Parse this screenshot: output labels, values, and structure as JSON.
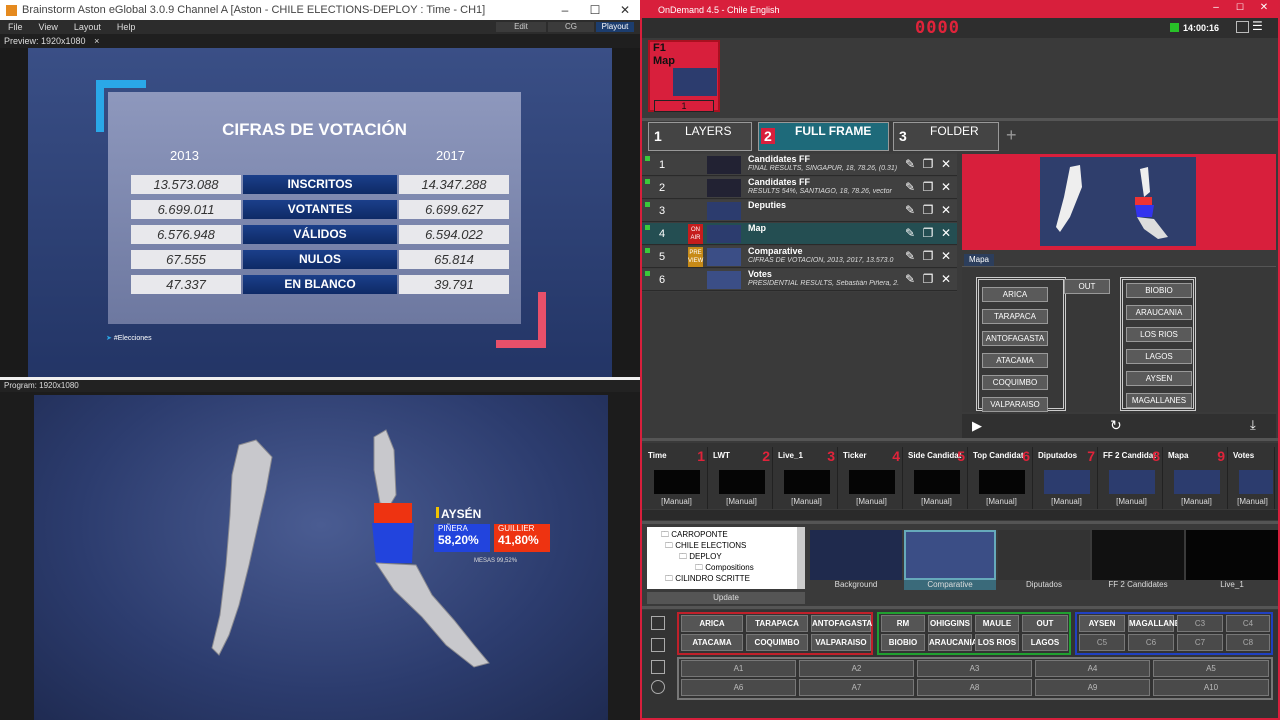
{
  "left_window": {
    "title": "Brainstorm Aston eGlobal 3.0.9  Channel A [Aston - CHILE ELECTIONS-DEPLOY : Time - CH1]",
    "menu": [
      "File",
      "View",
      "Layout",
      "Help"
    ],
    "mode_buttons": [
      "Edit",
      "CG",
      "Playout"
    ],
    "preview_tab": "Preview: 1920x1080",
    "program_tab": "Program: 1920x1080",
    "preview_graphic": {
      "title": "CIFRAS DE VOTACIÓN",
      "year_left": "2013",
      "year_right": "2017",
      "rows": [
        {
          "left": "13.573.088",
          "label": "INSCRITOS",
          "right": "14.347.288"
        },
        {
          "left": "6.699.011",
          "label": "VOTANTES",
          "right": "6.699.627"
        },
        {
          "left": "6.576.948",
          "label": "VÁLIDOS",
          "right": "6.594.022"
        },
        {
          "left": "67.555",
          "label": "NULOS",
          "right": "65.814"
        },
        {
          "left": "47.337",
          "label": "EN BLANCO",
          "right": "39.791"
        }
      ],
      "hashtag": "#Elecciones",
      "accent_blue": "#2aa8e8",
      "accent_red": "#e8506a"
    },
    "program_graphic": {
      "region": "AYSÉN",
      "candidate1": "PIÑERA",
      "pct1": "58,20%",
      "candidate2": "GUILLIER",
      "pct2": "41,80%",
      "mesas": "MESAS 99,52%",
      "color1": "#2244dd",
      "color2": "#ee3311"
    }
  },
  "right_window": {
    "title": "OnDemand 4.5 - Chile English",
    "counter": "0000",
    "clock": "14:00:16",
    "accent": "#d81f3c",
    "f1": {
      "key": "F1",
      "label": "Map",
      "page": "1"
    },
    "tabs": [
      {
        "num": "1",
        "label": "LAYERS"
      },
      {
        "num": "2",
        "label": "FULL FRAME"
      },
      {
        "num": "3",
        "label": "FOLDER"
      }
    ],
    "add_tab": "+",
    "rows": [
      {
        "num": "1",
        "title": "Candidates FF",
        "sub": "FINAL RESULTS, SINGAPUR, 18, 78.26, (0.31)",
        "status": ""
      },
      {
        "num": "2",
        "title": "Candidates FF",
        "sub": "RESULTS 54%, SANTIAGO, 18, 78.26, vector",
        "status": ""
      },
      {
        "num": "3",
        "title": "Deputies",
        "sub": "",
        "status": ""
      },
      {
        "num": "4",
        "title": "Map",
        "sub": "",
        "status": "ON AIR"
      },
      {
        "num": "5",
        "title": "Comparative",
        "sub": "CIFRAS DE VOTACIÓN, 2013, 2017, 13.573.0",
        "status": "PRE VIEW"
      },
      {
        "num": "6",
        "title": "Votes",
        "sub": "PRESIDENTIAL RESULTS, Sebastián Piñera, 2.",
        "status": ""
      }
    ],
    "mapa_tab": "Mapa",
    "mapa_left": [
      "ARICA",
      "TARAPACA",
      "ANTOFAGASTA",
      "ATACAMA",
      "COQUIMBO",
      "VALPARAISO"
    ],
    "mapa_out": "OUT",
    "mapa_right": [
      "BIOBIO",
      "ARAUCANIA",
      "LOS RIOS",
      "LAGOS",
      "AYSEN",
      "MAGALLANES"
    ],
    "macros": [
      {
        "title": "Time",
        "num": "1",
        "mode": "[Manual]"
      },
      {
        "title": "LWT",
        "num": "2",
        "mode": "[Manual]"
      },
      {
        "title": "Live_1",
        "num": "3",
        "mode": "[Manual]"
      },
      {
        "title": "Ticker",
        "num": "4",
        "mode": "[Manual]"
      },
      {
        "title": "Side Candidat",
        "num": "5",
        "mode": "[Manual]"
      },
      {
        "title": "Top Candidat",
        "num": "6",
        "mode": "[Manual]"
      },
      {
        "title": "Diputados",
        "num": "7",
        "mode": "[Manual]"
      },
      {
        "title": "FF 2 Candidat",
        "num": "8",
        "mode": "[Manual]"
      },
      {
        "title": "Mapa",
        "num": "9",
        "mode": "[Manual]"
      },
      {
        "title": "Votes",
        "num": "",
        "mode": "[Manual]"
      }
    ],
    "tree": [
      "CARROPONTE",
      "CHILE ELECTIONS",
      "DEPLOY",
      "Compositions",
      "CILINDRO SCRITTE"
    ],
    "update": "Update",
    "gallery": [
      "Background",
      "Comparative",
      "Diputados",
      "FF 2 Candidates",
      "Live_1"
    ],
    "bottom": {
      "red_group": [
        "ARICA",
        "TARAPACA",
        "ANTOFAGASTA",
        "ATACAMA",
        "COQUIMBO",
        "VALPARAISO"
      ],
      "green_group": [
        "RM",
        "OHIGGINS",
        "MAULE",
        "OUT",
        "BIOBIO",
        "ARAUCANIA",
        "LOS RIOS",
        "LAGOS"
      ],
      "blue_group": [
        "AYSEN",
        "MAGALLANES",
        "C3",
        "C4",
        "C5",
        "C6",
        "C7",
        "C8"
      ],
      "a_row1": [
        "A1",
        "A2",
        "A3",
        "A4",
        "A5"
      ],
      "a_row2": [
        "A6",
        "A7",
        "A8",
        "A9",
        "A10"
      ]
    }
  }
}
